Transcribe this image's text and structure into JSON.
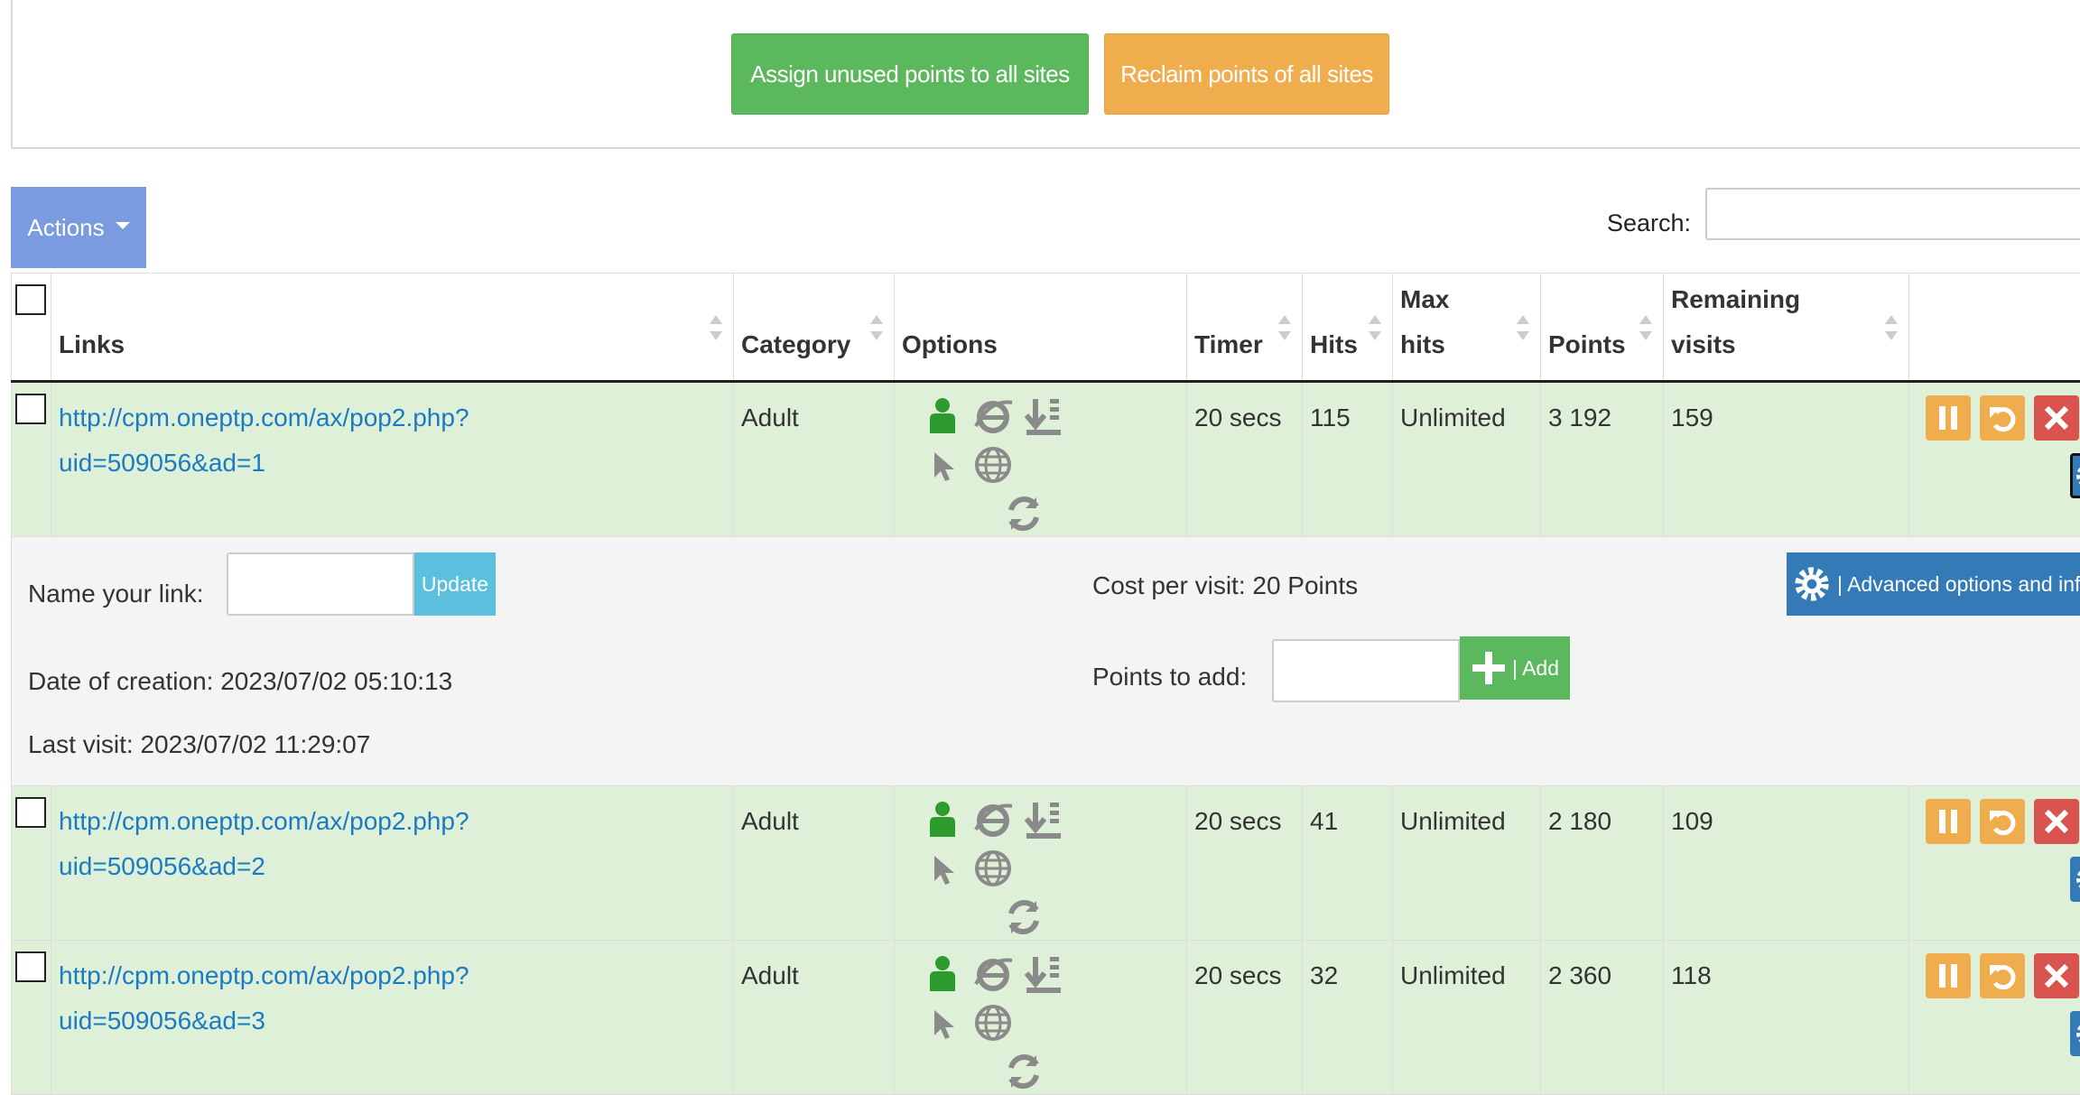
{
  "top": {
    "assign_label": "Assign unused points to all sites",
    "reclaim_label": "Reclaim points of all sites"
  },
  "toolbar": {
    "actions_label": "Actions",
    "search_label": "Search:",
    "search_value": ""
  },
  "table": {
    "headers": {
      "links": "Links",
      "category": "Category",
      "options": "Options",
      "timer": "Timer",
      "hits": "Hits",
      "max_hits_1": "Max",
      "max_hits_2": "hits",
      "points": "Points",
      "remaining_1": "Remaining",
      "remaining_2": "visits"
    },
    "rows": [
      {
        "link_1": "http://cpm.oneptp.com/ax/pop2.php?",
        "link_2": "uid=509056&ad=1",
        "category": "Adult",
        "timer": "20 secs",
        "hits": "115",
        "max_hits": "Unlimited",
        "points": "3 192",
        "remaining": "159"
      },
      {
        "link_1": "http://cpm.oneptp.com/ax/pop2.php?",
        "link_2": "uid=509056&ad=2",
        "category": "Adult",
        "timer": "20 secs",
        "hits": "41",
        "max_hits": "Unlimited",
        "points": "2 180",
        "remaining": "109"
      },
      {
        "link_1": "http://cpm.oneptp.com/ax/pop2.php?",
        "link_2": "uid=509056&ad=3",
        "category": "Adult",
        "timer": "20 secs",
        "hits": "32",
        "max_hits": "Unlimited",
        "points": "2 360",
        "remaining": "118"
      }
    ],
    "detail": {
      "name_label": "Name your link:",
      "update_label": "Update",
      "cost_label": "Cost per visit: 20 Points",
      "advanced_label": "| Advanced options and info",
      "points_add_label": "Points to add:",
      "add_label": "| Add",
      "created_label": "Date of creation: 2023/07/02 05:10:13",
      "last_visit_label": "Last visit: 2023/07/02 11:29:07"
    }
  },
  "colors": {
    "green": "#5cb85c",
    "orange": "#f0ad4e",
    "red": "#d9534f",
    "blue": "#337ab7",
    "actions": "#7b9be0",
    "row_bg": "#dff0d8",
    "link": "#1a7bc4"
  },
  "icons": [
    "person-icon",
    "ie-icon",
    "download-icon",
    "pointer-icon",
    "globe-icon",
    "refresh-icon",
    "pause-icon",
    "undo-icon",
    "close-icon",
    "gear-icon",
    "plus-icon"
  ]
}
